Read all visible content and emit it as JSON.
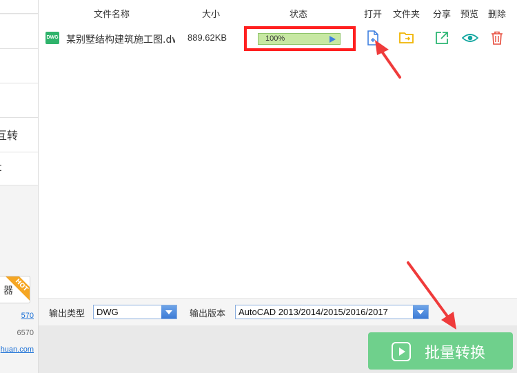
{
  "sidebar": {
    "items": [
      {
        "label": ""
      },
      {
        "label": ""
      },
      {
        "label": ""
      },
      {
        "label": "互转"
      },
      {
        "label": "t"
      }
    ],
    "promo_button": "器",
    "hot_badge": "HOT",
    "link_phone": "570",
    "grey_phone": "6570",
    "website": "huan.com"
  },
  "table": {
    "headers": {
      "filename": "文件名称",
      "size": "大小",
      "status": "状态",
      "open": "打开",
      "folder": "文件夹",
      "share": "分享",
      "preview": "预览",
      "delete": "删除"
    },
    "rows": [
      {
        "type_badge": "DWG",
        "filename": "某别墅结构建筑施工图.dwg",
        "size": "889.62KB",
        "progress_text": "100%",
        "progress": 1.0
      }
    ]
  },
  "options": {
    "output_type_label": "输出类型",
    "output_type_value": "DWG",
    "output_version_label": "输出版本",
    "output_version_value": "AutoCAD 2013/2014/2015/2016/2017"
  },
  "convert_button": {
    "label": "批量转换"
  },
  "colors": {
    "accent_green": "#6fd08c",
    "highlight_red": "#ff2020",
    "annotation_red": "#ef3b3b",
    "open_blue": "#3d7fe0",
    "folder_yellow": "#f0b400",
    "share_green": "#2bb673",
    "preview_teal": "#12a6a0",
    "delete_red": "#e74c3c"
  },
  "icons": [
    "dwg-file-icon",
    "play-icon",
    "open-file-icon",
    "folder-icon",
    "share-icon",
    "eye-icon",
    "trash-icon",
    "convert-play-icon",
    "dropdown-arrow-icon"
  ]
}
